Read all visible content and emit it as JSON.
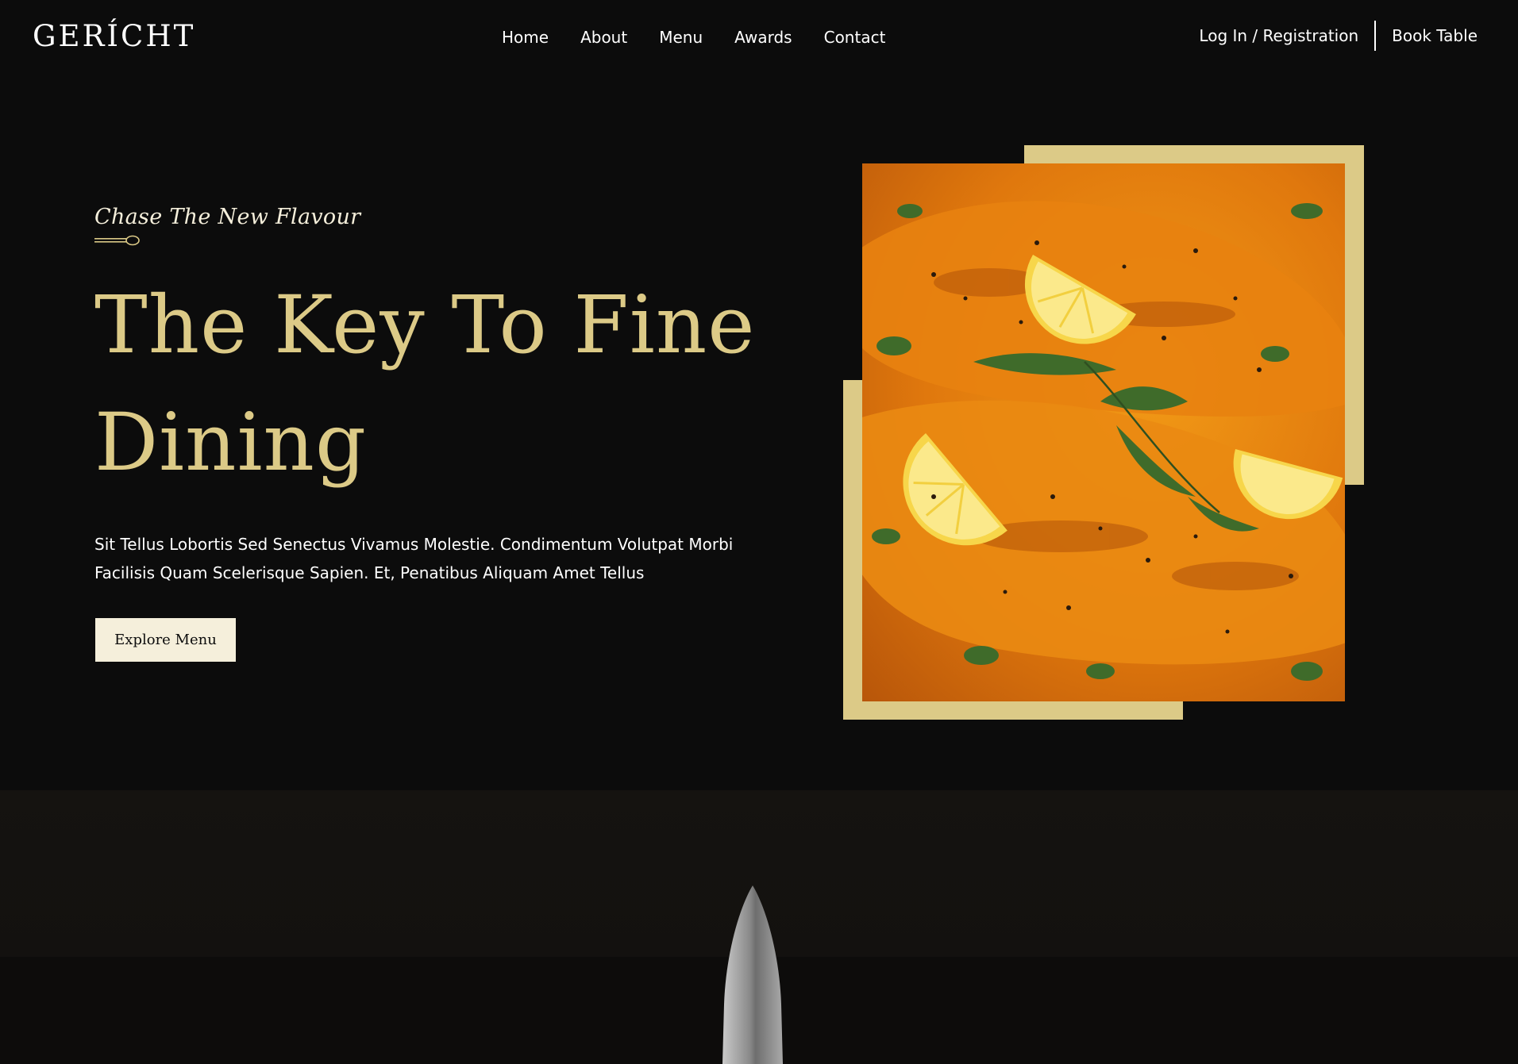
{
  "brand": {
    "logo": "GERÍCHT"
  },
  "nav": {
    "links": [
      "Home",
      "About",
      "Menu",
      "Awards",
      "Contact"
    ],
    "login": "Log In / Registration",
    "book": "Book Table"
  },
  "hero": {
    "subtitle": "Chase The New Flavour",
    "headline": "The Key To Fine Dining",
    "description": "Sit Tellus Lobortis Sed Senectus Vivamus Molestie. Condimentum Volutpat Morbi Facilisis Quam Scelerisque Sapien. Et, Penatibus Aliquam Amet Tellus",
    "cta": "Explore Menu"
  },
  "colors": {
    "background": "#0c0c0c",
    "golden": "#dcca87",
    "cream": "#f5efdb",
    "white": "#ffffff"
  },
  "icons": {
    "divider": "spoon-icon",
    "bottom": "knife-icon"
  }
}
